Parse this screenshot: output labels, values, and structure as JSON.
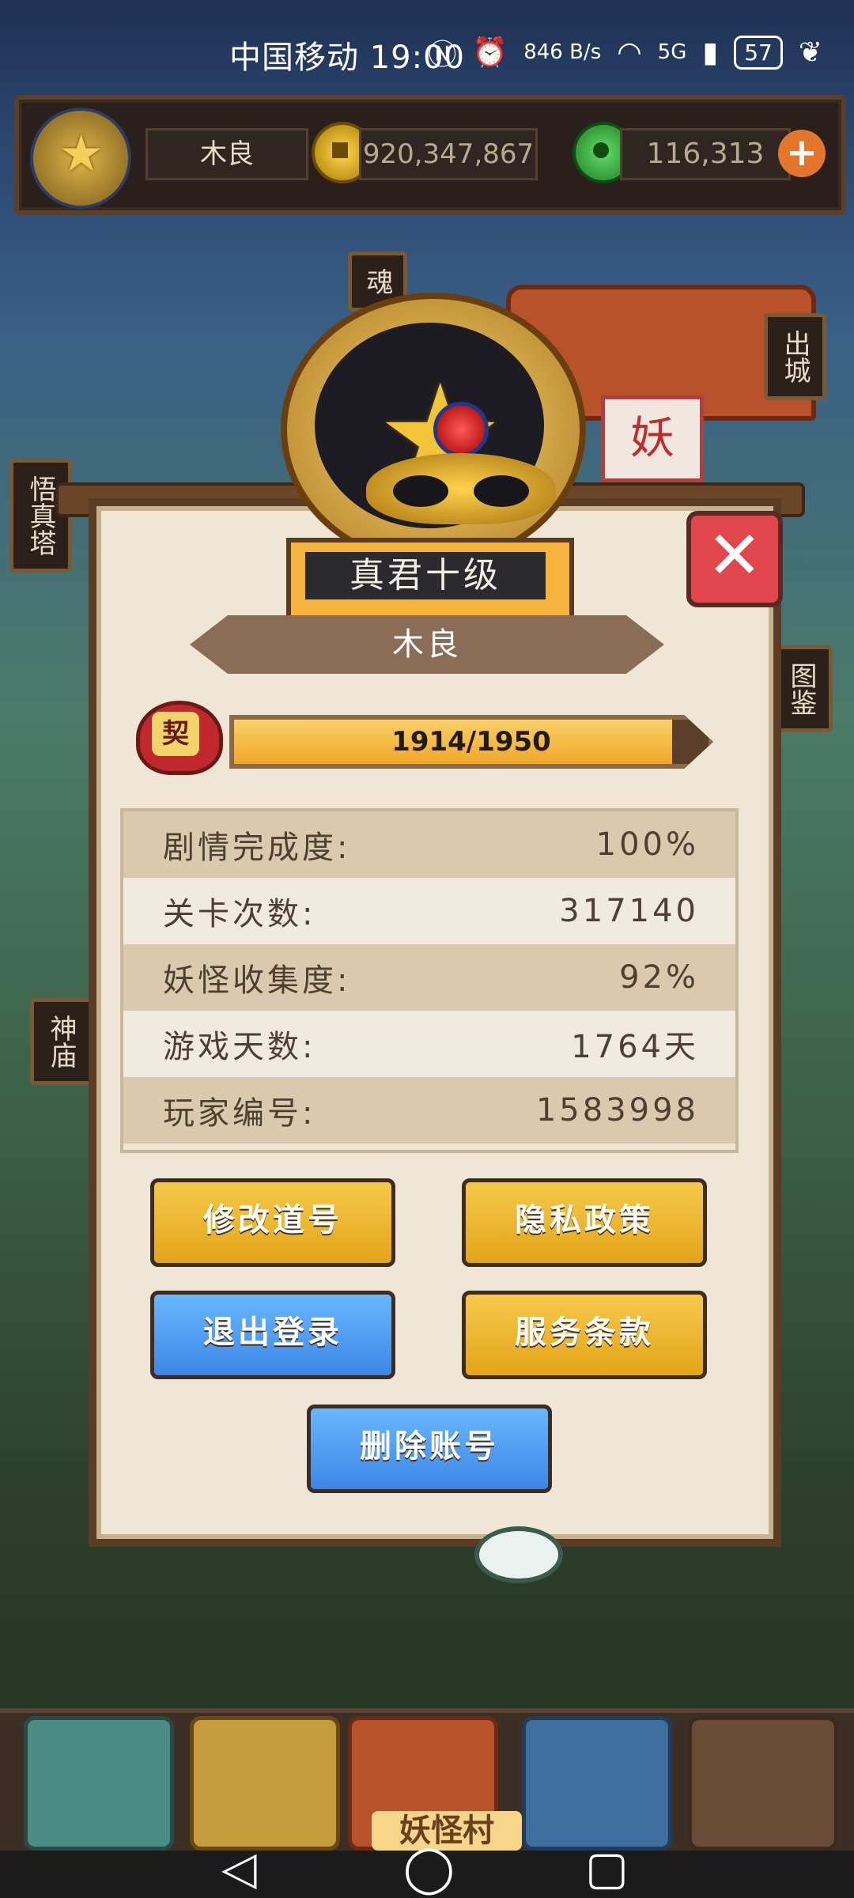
{
  "status_bar": {
    "carrier_time": "中国移动 19:00",
    "net_speed": "846 B/s",
    "signal": "5G",
    "battery": "57",
    "icons": [
      "nfc-icon",
      "alarm-icon",
      "wifi-icon",
      "signal-icon",
      "battery-icon",
      "leaf-icon"
    ]
  },
  "hud": {
    "player_name": "木良",
    "coins": "920,347,867",
    "jade": "116,313",
    "plus_label": "+"
  },
  "side_signs": {
    "wuzhen_ta": "悟真塔",
    "shenmiao": "神庙",
    "chucheng": "出城",
    "tujian": "图鉴",
    "hun": "魂"
  },
  "background": {
    "torii_plaque": "妖"
  },
  "profile": {
    "rank": "真君十级",
    "name": "木良",
    "contract_badge": "契",
    "xp_current": 1914,
    "xp_max": 1950,
    "xp_text": "1914/1950",
    "stats": [
      {
        "label": "剧情完成度:",
        "value": "100%"
      },
      {
        "label": "关卡次数:",
        "value": "317140"
      },
      {
        "label": "妖怪收集度:",
        "value": "92%"
      },
      {
        "label": "游戏天数:",
        "value": "1764天"
      },
      {
        "label": "玩家编号:",
        "value": "1583998"
      }
    ],
    "buttons": {
      "change_name": "修改道号",
      "privacy": "隐私政策",
      "logout": "退出登录",
      "terms": "服务条款",
      "delete": "删除账号"
    },
    "close_label": "✕"
  },
  "dock": {
    "village_label": "妖怪村"
  },
  "navbar": {
    "back": "◁",
    "home": "◯",
    "recents": "▢"
  }
}
